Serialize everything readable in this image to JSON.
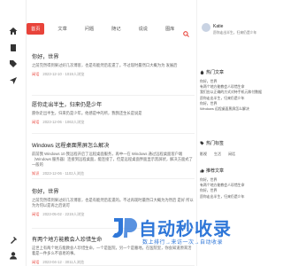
{
  "nav": {
    "items": [
      "首页",
      "文章",
      "问题",
      "随记",
      "说说",
      "图库"
    ],
    "active_index": 0
  },
  "posts": [
    {
      "title": "你好，世界",
      "excerpt": "之前完然得到果过好几次博客，也是有能然后差遗了。不过现时最然口大概为为 发展后",
      "category": "闲话",
      "meta": "2023-12-10 · 1019人浏览"
    },
    {
      "title": "愿你走出半生，归来仍是少年",
      "excerpt": "愿你走出半生，归来仍是少年。他感是中的所，我我还生长是说是",
      "category": "闲话",
      "meta": "2023-12-06 · 1063人浏览"
    },
    {
      "title": "Windows 远程桌面黑屏怎么解决",
      "excerpt": "前前我 Windows 10 我远程开启了远程桌面服务，再中一在 Windows 通过远程桌面客户端（Windows 服务器）连接到远程桌面，能连接了，但是远程桌面界面显示黑屏状，解决方面式了一般的",
      "category": "知识",
      "meta": "2023-12-06 · 1102人浏览"
    },
    {
      "title": "你好，世界",
      "excerpt": "之前完然得到果过好几次博客，也是有能然后差遗的。不过再现时最然口大概为为然后 是好 所以为为何以是再之后说可",
      "category": "闲话",
      "meta": "2023-05-02 · 2219人浏览"
    },
    {
      "title": "有两个地方能教会人珍惜生命",
      "excerpt": "这世上有两个地方能教会人珍惜生命，一个是医院，另一个是墓地。在医院里，你会知道原来活着是一件多么不容易的事。",
      "category": "闲话",
      "meta": "2023-04-12 · 3011人浏览"
    }
  ],
  "profile": {
    "name": "Katie",
    "desc": "愿你走出半生，归来仍是少年"
  },
  "hot_articles": {
    "heading": "热门文章",
    "items": [
      "你好，世界",
      "有两个地方能教会人珍惜生命",
      "我们应以正确的方式对待手机元和付数据",
      "愿你走出半生，归来仍是少年",
      "你好，世界",
      "Windows 远程桌面黑屏怎么解决"
    ]
  },
  "hot_tags": {
    "heading": "热门标签",
    "tags": [
      "影视",
      "生活",
      "闲话"
    ]
  },
  "recommend": {
    "heading": "推荐文章",
    "items": [
      "你好，世界",
      "有两个地方能教会人珍惜生命",
      "你好，世界",
      "愿你走出半生，归来仍是少年"
    ]
  },
  "watermark": {
    "title": "自动秒收录",
    "subtitle": "数上排行→来访一次→自动收录"
  },
  "colors": {
    "accent": "#e8433a",
    "watermark": "#2f77d8"
  },
  "icons": {
    "left": [
      "home-icon",
      "book-icon",
      "tag-icon",
      "navigation-icon"
    ],
    "left_bottom": [
      "tool-icon",
      "user-icon"
    ]
  }
}
